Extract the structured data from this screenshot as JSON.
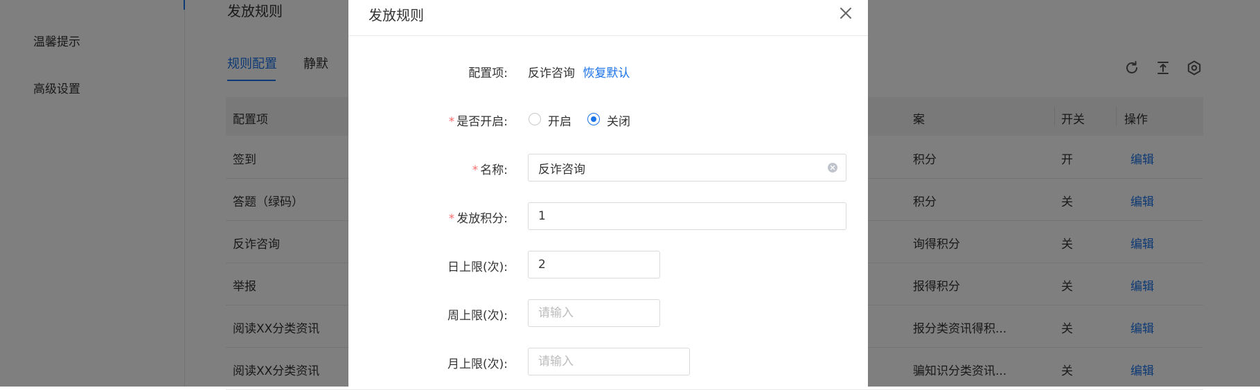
{
  "sidebar": {
    "items": [
      {
        "label": "温馨提示"
      },
      {
        "label": "高级设置"
      }
    ]
  },
  "page": {
    "title": "发放规则",
    "tabs": [
      {
        "label": "规则配置",
        "active": true
      },
      {
        "label": "静默"
      }
    ],
    "toolbar": {
      "icons": [
        "refresh-icon",
        "export-icon",
        "settings-icon"
      ]
    }
  },
  "table": {
    "headers": [
      "配置项",
      "案",
      "开关",
      "操作"
    ],
    "rows": [
      {
        "item": "签到",
        "desc": "积分",
        "switch": "开",
        "action": "编辑"
      },
      {
        "item": "答题（绿码）",
        "desc": "积分",
        "switch": "关",
        "action": "编辑"
      },
      {
        "item": "反诈咨询",
        "desc": "询得积分",
        "switch": "关",
        "action": "编辑"
      },
      {
        "item": "举报",
        "desc": "报得积分",
        "switch": "关",
        "action": "编辑"
      },
      {
        "item": "阅读XX分类资讯",
        "desc": "报分类资讯得积...",
        "switch": "关",
        "action": "编辑"
      },
      {
        "item": "阅读XX分类资讯",
        "desc": "骗知识分类资讯...",
        "switch": "关",
        "action": "编辑"
      }
    ]
  },
  "modal": {
    "title": "发放规则",
    "close_icon": "close-icon",
    "config_item": {
      "label": "配置项:",
      "value": "反诈咨询",
      "restore_link": "恢复默认"
    },
    "enabled": {
      "label": "是否开启:",
      "options": [
        "开启",
        "关闭"
      ],
      "selected": "关闭"
    },
    "name": {
      "label": "名称:",
      "value": "反诈咨询"
    },
    "points": {
      "label": "发放积分:",
      "value": "1"
    },
    "daily_limit": {
      "label": "日上限(次):",
      "value": "2"
    },
    "weekly_limit": {
      "label": "周上限(次):",
      "value": "",
      "placeholder": "请输入"
    },
    "monthly_limit": {
      "label": "月上限(次):",
      "value": "",
      "placeholder": "请输入"
    },
    "required_mark": "*"
  },
  "colors": {
    "accent": "#1a73e8",
    "required": "#f56c6c",
    "overlay": "rgba(0,0,0,0.5)"
  }
}
